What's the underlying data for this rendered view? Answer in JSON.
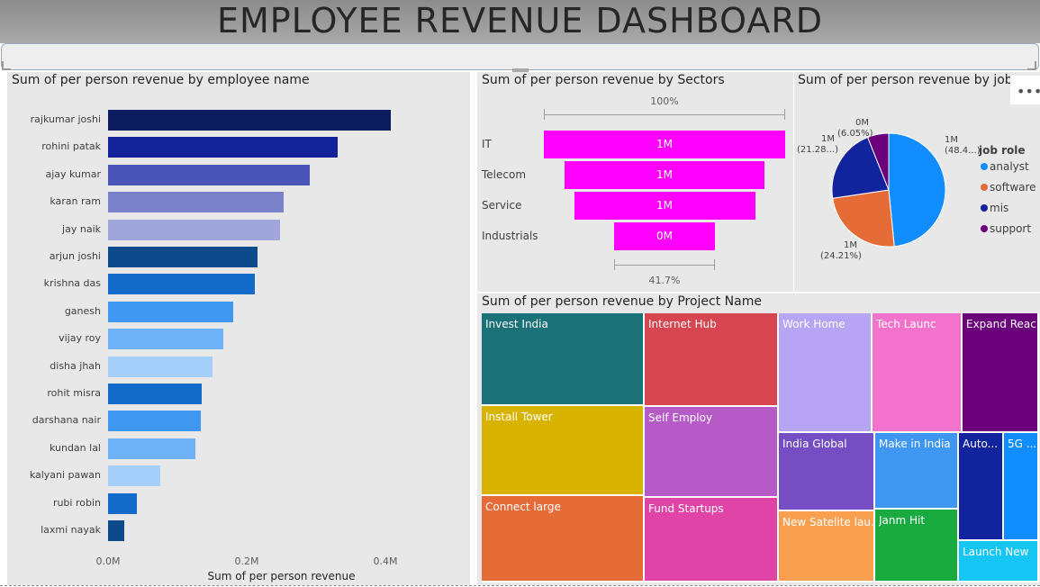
{
  "header": {
    "title": "EMPLOYEE REVENUE DASHBOARD"
  },
  "employee_chart": {
    "title": "Sum of per person revenue by employee name",
    "xlabel": "Sum of per person revenue",
    "ticks": [
      "0.0M",
      "0.2M",
      "0.4M"
    ]
  },
  "sector_chart": {
    "title": "Sum of per person revenue by Sectors",
    "top_percent": "100%",
    "bottom_percent": "41.7%"
  },
  "job_chart": {
    "title": "Sum of per person revenue by job role",
    "legend_title": "job role",
    "slice_labels": [
      {
        "value": "1M",
        "pct": "(48.4...)"
      },
      {
        "value": "1M",
        "pct": "(24.21%)"
      },
      {
        "value": "1M",
        "pct": "(21.28...)"
      },
      {
        "value": "0M",
        "pct": "(6.05%)"
      }
    ],
    "more_icon": "more-options-icon"
  },
  "project_chart": {
    "title": "Sum of per person revenue by Project Name"
  },
  "chart_data": [
    {
      "type": "bar",
      "orientation": "horizontal",
      "title": "Sum of per person revenue by employee name",
      "xlabel": "Sum of per person revenue",
      "xlim": [
        0,
        0.4
      ],
      "units": "M",
      "categories": [
        "rajkumar joshi",
        "rohini patak",
        "ajay kumar",
        "karan ram",
        "jay naik",
        "arjun joshi",
        "krishna das",
        "ganesh",
        "vijay roy",
        "disha jhah",
        "rohit misra",
        "darshana nair",
        "kundan lal",
        "kalyani pawan",
        "rubi robin",
        "laxmi nayak"
      ],
      "values": [
        0.408,
        0.331,
        0.291,
        0.253,
        0.248,
        0.215,
        0.212,
        0.181,
        0.166,
        0.15,
        0.135,
        0.134,
        0.126,
        0.075,
        0.042,
        0.023
      ],
      "colors": [
        "#0c1a5e",
        "#15239b",
        "#4a55b8",
        "#7a82cb",
        "#a0a6da",
        "#0d4a8c",
        "#126ac9",
        "#3f97f2",
        "#6db2f7",
        "#a4d0fb",
        "#126ac9",
        "#3f97f2",
        "#6db2f7",
        "#a4d0fb",
        "#126ac9",
        "#0d4a8c"
      ]
    },
    {
      "type": "funnel",
      "title": "Sum of per person revenue by Sectors",
      "categories": [
        "IT",
        "Telecom",
        "Service",
        "Industrials"
      ],
      "values": [
        1.0,
        0.83,
        0.75,
        0.417
      ],
      "labels": [
        "1M",
        "1M",
        "1M",
        "0M"
      ],
      "color": "#ff00ff"
    },
    {
      "type": "pie",
      "title": "Sum of per person revenue by job role",
      "legend": "right",
      "categories": [
        "analyst",
        "software",
        "mis",
        "support"
      ],
      "values": [
        48.4,
        24.21,
        21.28,
        6.05
      ],
      "colors": [
        "#118dff",
        "#e66c37",
        "#12239e",
        "#6b007b"
      ]
    },
    {
      "type": "treemap",
      "title": "Sum of per person revenue by Project Name",
      "categories": [
        "Invest India",
        "Install Tower",
        "Connect large",
        "Internet Hub",
        "Self Employ",
        "Fund Startups",
        "Work Home",
        "Tech Launc",
        "Expand Reach",
        "India Global",
        "Make in India",
        "Auto...",
        "5G ...",
        "New Satelite lau...",
        "Janm Hit",
        "Launch New"
      ],
      "colors": [
        "#1a7278",
        "#d8b400",
        "#e66c37",
        "#d64550",
        "#b55ac6",
        "#e044a7",
        "#b7a4f4",
        "#f373cc",
        "#6b007b",
        "#744ec2",
        "#3f97f2",
        "#12239e",
        "#118dff",
        "#f8a050",
        "#1aab40",
        "#15c6f4"
      ]
    }
  ]
}
